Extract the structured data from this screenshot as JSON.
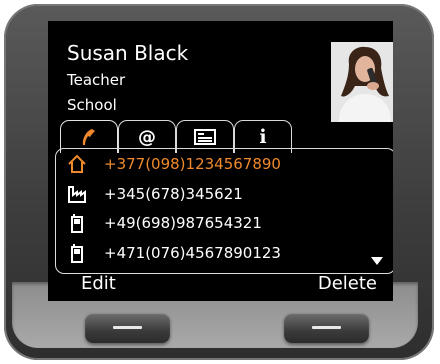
{
  "contact": {
    "name": "Susan Black",
    "line1": "Teacher",
    "line2": "School"
  },
  "tabs": [
    {
      "icon": "phone-handset-icon",
      "active": true
    },
    {
      "icon": "at-sign-icon",
      "label": "@"
    },
    {
      "icon": "business-card-icon"
    },
    {
      "icon": "info-icon",
      "label": "i"
    }
  ],
  "numbers": [
    {
      "type": "home-icon",
      "value": "+377(098)1234567890",
      "selected": true
    },
    {
      "type": "office-icon",
      "value": "+345(678)345621"
    },
    {
      "type": "mobile-icon",
      "value": "+49(698)987654321"
    },
    {
      "type": "mobile-icon",
      "value": "+471(076)4567890123"
    }
  ],
  "softkeys": {
    "left": "Edit",
    "right": "Delete"
  },
  "colors": {
    "accent": "#f08a2c",
    "screen": "#000000",
    "text": "#ffffff"
  }
}
